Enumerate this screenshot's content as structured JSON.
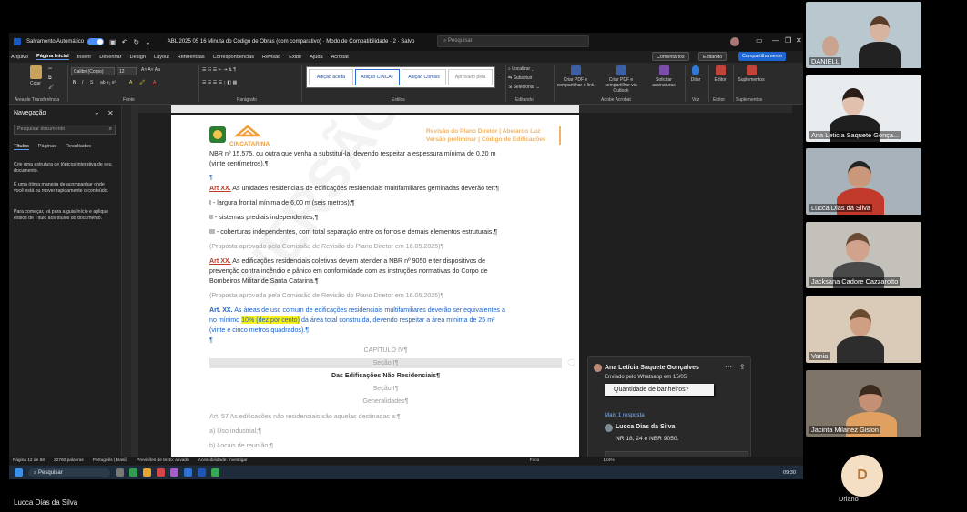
{
  "window": {
    "autosave_label": "Salvamento Automático",
    "doc_title": "ABL 2025 05 16 Minuta do Código de Obras (com comparativo)  ·  Modo de Compatibilidade  ·  2  ·  Salvo",
    "search_placeholder": "Pesquisar"
  },
  "menu": {
    "items": [
      "Arquivo",
      "Página Inicial",
      "Inserir",
      "Desenhar",
      "Design",
      "Layout",
      "Referências",
      "Correspondências",
      "Revisão",
      "Exibir",
      "Ajuda",
      "Acrobat"
    ],
    "comments": "Comentários",
    "editing": "Editando",
    "share": "Compartilhamento"
  },
  "ribbon": {
    "paste": "Colar",
    "clipboard": "Área de Transferência",
    "font_name": "Calibri (Corpo)",
    "font_size": "12",
    "font_group": "Fonte",
    "paragraph_group": "Parágrafo",
    "styles_group": "Estilos",
    "styles": [
      "Adição aceita",
      "Adição CINCAT",
      "Adição Comiss",
      "Aprovado pela"
    ],
    "find": "Localizar",
    "replace": "Substituir",
    "select": "Selecionar",
    "editing_group": "Editando",
    "pdf_share": "Criar PDF e compartilhar o link",
    "pdf_outlook": "Criar PDF e compartilhar via Outlook",
    "signatures": "Solicitar assinaturas",
    "acrobat_group": "Adobe Acrobat",
    "dictate": "Ditar",
    "voice_group": "Voz",
    "editor": "Editor",
    "addins": "Suplementos"
  },
  "nav": {
    "title": "Navegação",
    "search_placeholder": "Pesquisar documento",
    "tabs": [
      "Títulos",
      "Páginas",
      "Resultados"
    ],
    "p1": "Crie uma estrutura de tópicos interativa de seu documento.",
    "p2": "É uma ótima maneira de acompanhar onde você está ou mover rapidamente o conteúdo.",
    "p3": "Para começar, vá para a guia Início e aplique estilos de Título aos títulos do documento."
  },
  "doc": {
    "logo_text": "CINCATARINA",
    "header_line1": "Revisão do Plano Diretor | Abelardo Luz",
    "header_line2": "Versão preliminar | Código de Edificações",
    "watermark": "VERSÃO PRELIMINAR",
    "l1": "NBR nº 15.575, ou outra que venha a substituí-la, devendo respeitar a espessura mínima de 0,20 m",
    "l2": "(vinte centímetros).¶",
    "l3": "¶",
    "l4_bold": "Art XX.",
    "l4": " As unidades residenciais de edificações residenciais multifamiliares geminadas deverão ter:¶",
    "l5": "I - largura frontal mínima de 6,00 m (seis metros);¶",
    "l6": "II - sistemas prediais independentes;¶",
    "l7": "III - coberturas independentes, com total separação entre os forros e demais elementos estruturais.¶",
    "l8": "(Proposta aprovada pela Comissão de Revisão do Plano Diretor em 16.05.2025)¶",
    "l9_bold": "Art XX.",
    "l9": " As edificações residenciais coletivas devem atender a NBR nº 9050 e ter dispositivos de",
    "l10": "prevenção contra incêndio e pânico em conformidade com as instruções normativas do Corpo de",
    "l11": "Bombeiros Militar de Santa Catarina.¶",
    "l12": "(Proposta aprovada pela Comissão de Revisão do Plano Diretor em 16.05.2025)¶",
    "l13_bold": "Art. XX.",
    "l13": " As áreas de uso comum de edificações residenciais multifamiliares deverão ser equivalentes a",
    "l14a": "no mínimo ",
    "l14_hl": "10% (dez por cento)",
    "l14b": " da área total construída, devendo respeitar a área mínima de 25 m²",
    "l15": "(vinte e cinco metros quadrados).¶",
    "l16": "¶",
    "chapter": "CAPÍTULO IV¶",
    "section": "Seção I¶",
    "section_title": "Das Edificações Não Residenciais¶",
    "section2": "Seção I¶",
    "general": "Generalidades¶",
    "art57": "Art. 57 As edificações não residenciais são aquelas destinadas a:¶",
    "item_a": "a) Uso industrial;¶",
    "item_b": "b) Locais de reunião;¶"
  },
  "comment": {
    "author": "Ana Letícia Saquete Gonçalves",
    "meta": "Enviado pelo Whatsapp em 15/05",
    "quote": "Quantidade de banheiros?",
    "more": "Mais 1 resposta",
    "reply_author": "Lucca Dias da Silva",
    "reply_text": "NR 18, 24 e NBR 9050."
  },
  "status": {
    "page": "Página 12 de 58",
    "words": "22760 palavras",
    "lang": "Português (Brasil)",
    "predict": "Previsões de texto: ativado",
    "access": "Acessibilidade: investigar",
    "focus": "Foco",
    "zoom": "124%"
  },
  "taskbar": {
    "search": "Pesquisar",
    "time": "09:30"
  },
  "participants": [
    {
      "name": "DANIELL",
      "bg": "#b9c7cf"
    },
    {
      "name": "Ana Leticia Saquete Gonça...",
      "bg": "#e8ecef"
    },
    {
      "name": "Lucca Dias da Silva",
      "bg": "#a8b2bb"
    },
    {
      "name": "Jacksana Cadore Cazzarotto",
      "bg": "#c4c1bb"
    },
    {
      "name": "Vania",
      "bg": "#d9cbb8"
    },
    {
      "name": "Jacinta Milanez Gislon",
      "bg": "#7f7468"
    }
  ],
  "speaker": "Lucca Dias da Silva",
  "driano": {
    "initial": "D",
    "name": "Driano"
  }
}
